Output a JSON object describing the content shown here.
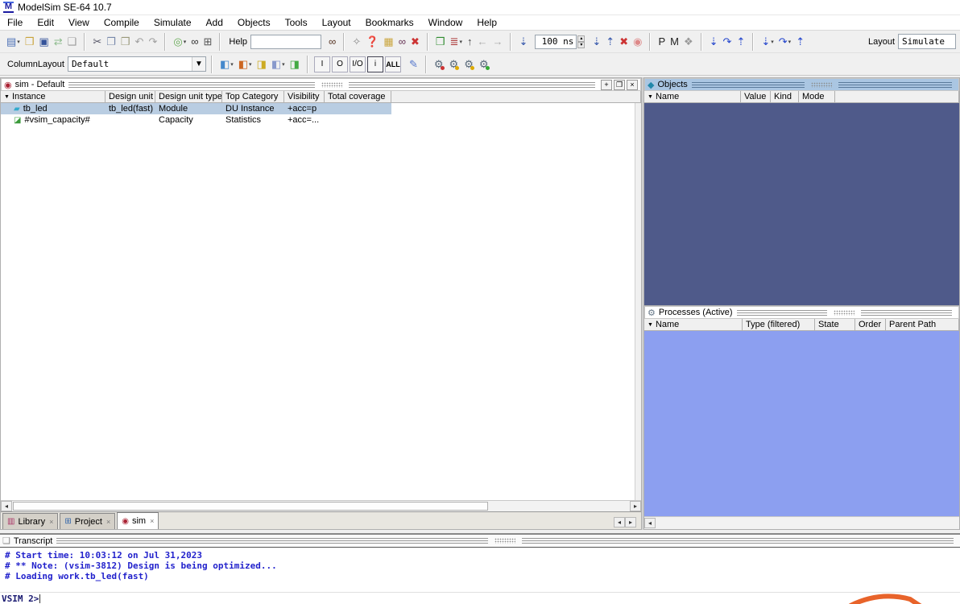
{
  "colors": {
    "objects-body": "#4F5A8A",
    "processes-body": "#8C9FF0",
    "objects-titlebar": "#AAC6E2",
    "selection": "#B9CDE2",
    "transcript-text": "#2222CC",
    "prompt-text": "#191970",
    "orange-mark": "#E8632A"
  },
  "window": {
    "title": "ModelSim SE-64 10.7",
    "logo": "M"
  },
  "menu": {
    "items": [
      "File",
      "Edit",
      "View",
      "Compile",
      "Simulate",
      "Add",
      "Objects",
      "Tools",
      "Layout",
      "Bookmarks",
      "Window",
      "Help"
    ]
  },
  "toolbar1": {
    "file_group": [
      {
        "name": "new-document-icon",
        "glyph": "▤",
        "color": "#4a6fb5",
        "dropdown": true
      },
      {
        "name": "open-folder-icon",
        "glyph": "❒",
        "color": "#c9a23a"
      },
      {
        "name": "save-icon",
        "glyph": "▣",
        "color": "#35539a"
      },
      {
        "name": "reload-icon",
        "glyph": "⇄",
        "color": "#8fbc8f"
      },
      {
        "name": "print-icon",
        "glyph": "❑",
        "color": "#9a9a9a"
      }
    ],
    "edit_group": [
      {
        "name": "cut-icon",
        "glyph": "✂",
        "color": "#556"
      },
      {
        "name": "copy-icon",
        "glyph": "❐",
        "color": "#7788aa"
      },
      {
        "name": "paste-icon",
        "glyph": "❒",
        "color": "#99987a"
      },
      {
        "name": "undo-icon",
        "glyph": "↶",
        "color": "#a0a0a0"
      },
      {
        "name": "redo-icon",
        "glyph": "↷",
        "color": "#a0a0a0"
      }
    ],
    "find_group": [
      {
        "name": "compile-options-icon",
        "glyph": "◎",
        "color": "#66aa55",
        "dropdown": true
      },
      {
        "name": "find-icon",
        "glyph": "∞",
        "color": "#333"
      },
      {
        "name": "expand-env-icon",
        "glyph": "⊞",
        "color": "#555"
      }
    ],
    "help_label": "Help",
    "help_value": "",
    "help_find_group": [
      {
        "name": "search-help-icon",
        "glyph": "∞",
        "color": "#553322"
      }
    ],
    "sim_tools_group": [
      {
        "name": "trace-icon",
        "glyph": "✧",
        "color": "#888"
      },
      {
        "name": "examine-icon",
        "glyph": "❓",
        "color": "#caa53d"
      },
      {
        "name": "show-ids-icon",
        "glyph": "▦",
        "color": "#caa53d"
      },
      {
        "name": "search-log-icon",
        "glyph": "∞",
        "color": "#663355"
      },
      {
        "name": "delete-icon",
        "glyph": "✖",
        "color": "#cc3333"
      }
    ],
    "restart_group": [
      {
        "name": "restart-icon",
        "glyph": "❒",
        "color": "#2e8b2e"
      },
      {
        "name": "run-length-icon",
        "glyph": "≣",
        "color": "#aa3333",
        "dropdown": true
      },
      {
        "name": "env-up-icon",
        "glyph": "↑",
        "color": "#444"
      },
      {
        "name": "env-back-icon",
        "glyph": "←",
        "color": "#aaa"
      },
      {
        "name": "env-forward-icon",
        "glyph": "→",
        "color": "#aaa"
      }
    ],
    "run_icon_group": [
      {
        "name": "run-icon",
        "glyph": "⇣",
        "color": "#3355aa"
      }
    ],
    "time_value": "100 ns",
    "spinner_up": "▴",
    "spinner_down": "▾",
    "run_after_group": [
      {
        "name": "run-all-icon",
        "glyph": "⇣",
        "color": "#3355aa"
      },
      {
        "name": "continue-run-icon",
        "glyph": "⇡",
        "color": "#3355aa"
      },
      {
        "name": "break-icon",
        "glyph": "✖",
        "color": "#cc3333"
      },
      {
        "name": "stop-icon",
        "glyph": "◉",
        "color": "#dd8888"
      }
    ],
    "profile_group": [
      {
        "name": "performance-profile-icon",
        "glyph": "P",
        "color": "#222"
      },
      {
        "name": "memory-profile-icon",
        "glyph": "M",
        "color": "#222"
      },
      {
        "name": "pan-hand-icon",
        "glyph": "❖",
        "color": "#999"
      }
    ],
    "step_group": [
      {
        "name": "step-into-icon",
        "glyph": "⇣",
        "color": "#2244cc"
      },
      {
        "name": "step-over-icon",
        "glyph": "↷",
        "color": "#2244cc"
      },
      {
        "name": "step-out-icon",
        "glyph": "⇡",
        "color": "#2244cc"
      }
    ],
    "step_current_group": [
      {
        "name": "step-into-current-icon",
        "glyph": "⇣",
        "color": "#2244cc",
        "dropdown": true
      },
      {
        "name": "step-over-current-icon",
        "glyph": "↷",
        "color": "#2244cc",
        "dropdown": true
      },
      {
        "name": "step-out-current-icon",
        "glyph": "⇡",
        "color": "#2244cc"
      }
    ],
    "layout_label": "Layout",
    "layout_value": "Simulate"
  },
  "toolbar2": {
    "columnlayout_label": "ColumnLayout",
    "columnlayout_value": "Default",
    "dropdown_arrow": "▼",
    "add_group": [
      {
        "name": "add-to-wave-icon",
        "glyph": "◧",
        "color": "#4488cc",
        "dropdown": true
      },
      {
        "name": "add-to-list-icon",
        "glyph": "◧",
        "color": "#cc6622",
        "dropdown": true
      },
      {
        "name": "add-to-log-icon",
        "glyph": "◨",
        "color": "#ccaa22"
      },
      {
        "name": "add-to-dataflow-icon",
        "glyph": "◧",
        "color": "#8899cc",
        "dropdown": true
      },
      {
        "name": "add-to-schematic-icon",
        "glyph": "◨",
        "color": "#44aa44"
      }
    ],
    "filter_buttons": [
      {
        "name": "filter-in-button",
        "label": "I"
      },
      {
        "name": "filter-out-button",
        "label": "O"
      },
      {
        "name": "filter-inout-button",
        "label": "I/O"
      },
      {
        "name": "filter-internal-button",
        "label": "i",
        "boxed": true
      },
      {
        "name": "filter-all-button",
        "label": "ALL",
        "bold": true
      }
    ],
    "brush_group": [
      {
        "name": "filter-edit-icon",
        "glyph": "✎",
        "color": "#5577cc"
      }
    ],
    "gear_group": [
      {
        "name": "processes-all-icon",
        "glyph": "⚙",
        "color": "#556677",
        "dot": "#cc3333"
      },
      {
        "name": "processes-region-icon",
        "glyph": "⚙",
        "color": "#556677",
        "dot": "#ddaa00"
      },
      {
        "name": "processes-hier-icon",
        "glyph": "⚙",
        "color": "#556677",
        "dot": "#ddaa00"
      },
      {
        "name": "processes-active-icon",
        "glyph": "⚙",
        "color": "#556677",
        "dot": "#33aa33"
      }
    ]
  },
  "sim_panel": {
    "title": "sim - Default",
    "icon": "◉",
    "filter_arrow": "▼",
    "winbuttons": {
      "add": "+",
      "undock": "❐",
      "close": "×"
    },
    "columns": [
      "Instance",
      "Design unit",
      "Design unit type",
      "Top Category",
      "Visibility",
      "Total coverage"
    ],
    "rows": [
      {
        "icon": "▰",
        "icon_color": "#33aacc",
        "instance": "tb_led",
        "design_unit": "tb_led(fast)",
        "design_unit_type": "Module",
        "top_category": "DU Instance",
        "visibility": "+acc=p",
        "total_coverage": ""
      },
      {
        "icon": "◪",
        "icon_color": "#3a9a3a",
        "instance": "#vsim_capacity#",
        "design_unit": "",
        "design_unit_type": "Capacity",
        "top_category": "Statistics",
        "visibility": "+acc=...",
        "total_coverage": ""
      }
    ],
    "tabs": [
      {
        "icon": "▥",
        "icon_color": "#aa3366",
        "label": "Library",
        "close": "×"
      },
      {
        "icon": "⊞",
        "icon_color": "#3366aa",
        "label": "Project",
        "close": "×"
      },
      {
        "icon": "◉",
        "icon_color": "#aa2233",
        "label": "sim",
        "close": "×"
      }
    ],
    "scroll": {
      "left": "◂",
      "right": "▸"
    }
  },
  "objects_panel": {
    "title": "Objects",
    "icon": "◆",
    "filter_arrow": "▼",
    "columns": [
      "Name",
      "Value",
      "Kind",
      "Mode"
    ]
  },
  "processes_panel": {
    "title": "Processes (Active)",
    "icon": "⚙",
    "filter_arrow": "▼",
    "columns": [
      "Name",
      "Type (filtered)",
      "State",
      "Order",
      "Parent Path"
    ],
    "scroll_left": "◂"
  },
  "transcript": {
    "title": "Transcript",
    "icon": "❏",
    "lines": [
      "# Start time: 10:03:12 on Jul 31,2023",
      "# ** Note: (vsim-3812) Design is being optimized...",
      "# Loading work.tb_led(fast)"
    ],
    "prompt": "VSIM 2>"
  }
}
